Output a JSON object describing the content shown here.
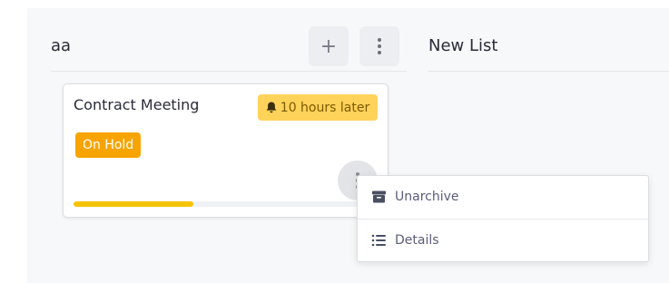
{
  "columns": [
    {
      "title": "aa",
      "add_icon": "plus-icon",
      "menu_icon": "more-vertical-icon",
      "cards": [
        {
          "title": "Contract Meeting",
          "due": {
            "icon": "bell-icon",
            "text": "10 hours later",
            "color": "#ffd25a"
          },
          "status": {
            "text": "On Hold",
            "color": "#f7a400"
          },
          "progress_percent": 42,
          "progress_color": "#f5c400",
          "menu_icon": "more-vertical-icon"
        }
      ]
    },
    {
      "title": "New List"
    }
  ],
  "context_menu": {
    "items": [
      {
        "label": "Unarchive",
        "icon": "archive-icon"
      },
      {
        "label": "Details",
        "icon": "list-icon"
      }
    ]
  }
}
